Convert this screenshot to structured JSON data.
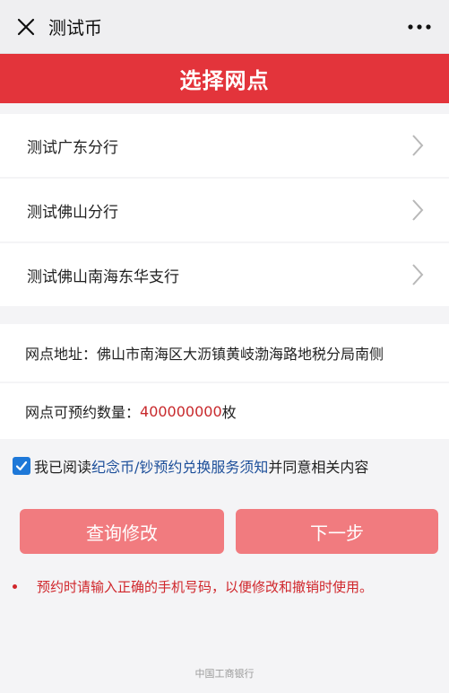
{
  "header": {
    "title": "测试币",
    "close_icon": "close-icon",
    "more_icon": "more-dots-icon"
  },
  "banner": {
    "title": "选择网点"
  },
  "branches": [
    {
      "label": "测试广东分行"
    },
    {
      "label": "测试佛山分行"
    },
    {
      "label": "测试佛山南海东华支行"
    }
  ],
  "info": {
    "address_label": "网点地址：",
    "address_value": "佛山市南海区大沥镇黄岐渤海路地税分局南侧",
    "quota_label": "网点可预约数量：",
    "quota_value": "400000000",
    "quota_unit": "枚"
  },
  "agreement": {
    "checked": true,
    "prefix": "我已阅读",
    "link": "纪念币/钞预约兑换服务须知",
    "suffix": "并同意相关内容"
  },
  "buttons": {
    "query_label": "查询修改",
    "next_label": "下一步"
  },
  "notice": "预约时请输入正确的手机号码，以便修改和撤销时使用。",
  "footer": "中国工商银行",
  "colors": {
    "banner": "#e3343b",
    "button": "#f17b7f",
    "link": "#1d4f9a",
    "accent_red": "#c8292c",
    "checkbox": "#1e78d8"
  }
}
